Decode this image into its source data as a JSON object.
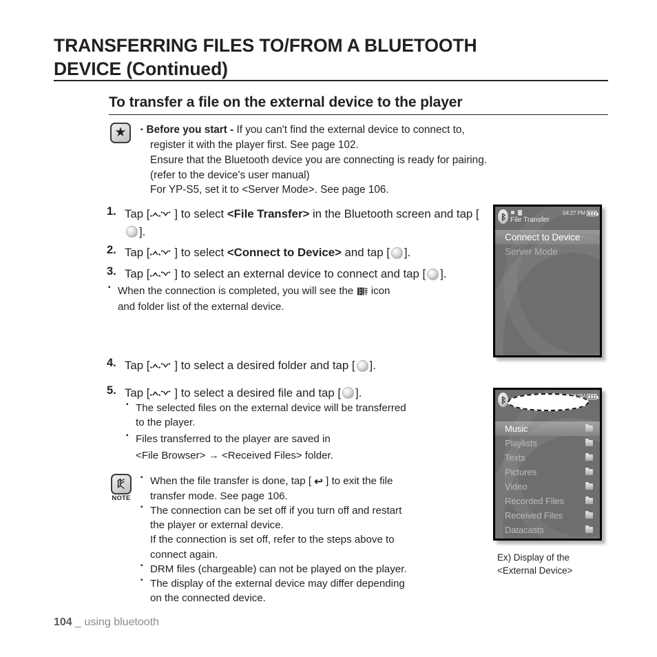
{
  "chapter": {
    "title_line1": "TRANSFERRING FILES TO/FROM A BLUETOOTH",
    "title_line2": "DEVICE (Continued)"
  },
  "section": {
    "heading": "To transfer a file on the external device to the player"
  },
  "tip": {
    "icon": "star-icon",
    "label": "Before you start -",
    "line1": "If you can't find the external device to connect to,",
    "line2": "register it with the player first. See page 102.",
    "line3": "Ensure that the Bluetooth device you are connecting is ready for pairing.",
    "line4": "(refer to the device's user manual)",
    "line5": "For YP-S5, set it to <Server Mode>. See page 106."
  },
  "steps": [
    {
      "num": "1.",
      "pre": "Tap [",
      "mid": "] to select ",
      "bold": "<File Transfer>",
      "post": " in the Bluetooth screen and tap [",
      "end": "]."
    },
    {
      "num": "2.",
      "pre": "Tap [",
      "mid": "] to select ",
      "bold": "<Connect to Device>",
      "post": " and tap [",
      "end": "]."
    },
    {
      "num": "3.",
      "pre": "Tap [",
      "mid": "] to select an external device to connect and tap [",
      "post": "",
      "bold": "",
      "end": "]."
    },
    {
      "num": "4.",
      "pre": "Tap [",
      "mid": "] to select a desired folder and tap [",
      "bold": "",
      "post": "",
      "end": "]."
    },
    {
      "num": "5.",
      "pre": "Tap [",
      "mid": "] to select a desired file and tap [",
      "bold": "",
      "post": "",
      "end": "]."
    }
  ],
  "step3_note": {
    "part1": "When the connection is completed, you will see the",
    "part2": "icon",
    "line2": "and folder list of the external device."
  },
  "step5_notes": [
    {
      "line1": "The selected files on the external device will be transferred",
      "line2": "to the player."
    },
    {
      "line1": "Files transferred to the player are saved in",
      "line2": "<File Browser> → <Received Files> folder."
    }
  ],
  "note_box": {
    "icon": "note-icon",
    "label": "NOTE",
    "items": [
      {
        "pre": "When the file transfer is done, tap [",
        "post": "] to exit the file",
        "line2": "transfer mode. See page 106.",
        "has_back_icon": true
      },
      {
        "pre": "The connection can be set off if you turn off and restart",
        "post": "",
        "line2": "the player or external device.",
        "line3": "If the connection is set off, refer to the steps above to",
        "line4": "connect again.",
        "has_back_icon": false
      },
      {
        "pre": "DRM files (chargeable) can not be played on the player.",
        "post": "",
        "has_back_icon": false
      },
      {
        "pre": "The display of the external device may differ depending",
        "post": "",
        "line2": "on the connected device.",
        "has_back_icon": false
      }
    ]
  },
  "device_one": {
    "status": {
      "title": "File Transfer",
      "time": "04:27 PM"
    },
    "menu": [
      {
        "label": "Connect to Device",
        "selected": true
      },
      {
        "label": "Server Mode",
        "selected": false
      }
    ]
  },
  "device_two": {
    "status": {
      "time": "04:27 PM"
    },
    "folders": [
      {
        "label": "Music",
        "selected": true
      },
      {
        "label": "Playlists",
        "selected": false
      },
      {
        "label": "Texts",
        "selected": false
      },
      {
        "label": "Pictures",
        "selected": false
      },
      {
        "label": "Video",
        "selected": false
      },
      {
        "label": "Recorded Files",
        "selected": false
      },
      {
        "label": "Received Files",
        "selected": false
      },
      {
        "label": "Datacasts",
        "selected": false
      }
    ]
  },
  "example_caption": {
    "line1": "Ex) Display of the",
    "line2": "<External Device>"
  },
  "footer": {
    "page": "104",
    "sep": "_",
    "section": "using bluetooth"
  },
  "colors": {
    "text": "#231f20",
    "screen_bg": "#6e6e6e",
    "footer": "#8c8c8c"
  }
}
